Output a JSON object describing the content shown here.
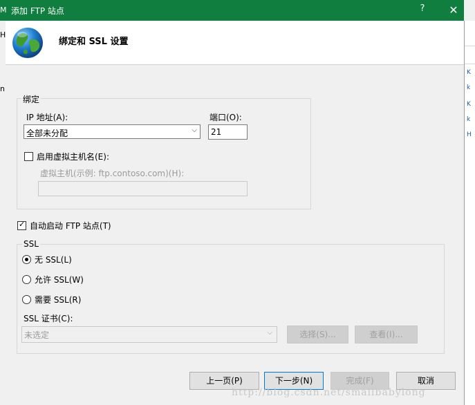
{
  "window": {
    "title": "添加 FTP 站点",
    "help_glyph": "?",
    "close_glyph": "✕"
  },
  "header": {
    "title": "绑定和 SSL 设置"
  },
  "background_fragments": {
    "m": "M",
    "h": "H",
    "n": "n",
    "side": [
      "K",
      "k",
      "K",
      "k",
      "H"
    ]
  },
  "binding": {
    "group_label": "绑定",
    "ip_label": "IP 地址(A):",
    "ip_value": "全部未分配",
    "port_label": "端口(O):",
    "port_value": "21",
    "virtual_host_checkbox_label": "启用虚拟主机名(E):",
    "virtual_host_checked": false,
    "virtual_host_label": "虚拟主机(示例: ftp.contoso.com)(H):",
    "virtual_host_value": ""
  },
  "auto_start": {
    "label": "自动启动 FTP 站点(T)",
    "checked": true
  },
  "ssl": {
    "group_label": "SSL",
    "options": [
      {
        "label": "无 SSL(L)",
        "selected": true
      },
      {
        "label": "允许 SSL(W)",
        "selected": false
      },
      {
        "label": "需要 SSL(R)",
        "selected": false
      }
    ],
    "cert_label": "SSL 证书(C):",
    "cert_value": "未选定",
    "select_button": "选择(S)...",
    "view_button": "查看(I)..."
  },
  "footer": {
    "prev_button": "上一页(P)",
    "next_button": "下一步(N)",
    "finish_button": "完成(F)",
    "cancel_button": "取消"
  },
  "watermark": "http://blog.csdn.net/smallbabylong",
  "colors": {
    "titlebar": "#0f7e3f",
    "focus_border": "#0078d7",
    "dialog_bg": "#f0f0f0"
  }
}
